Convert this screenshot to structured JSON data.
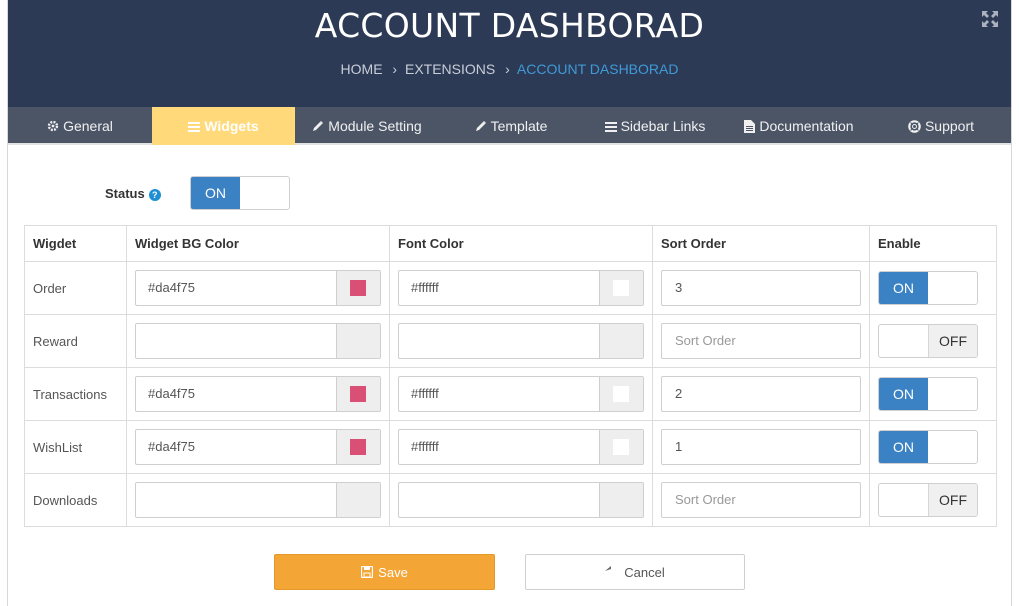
{
  "header": {
    "title": "ACCOUNT DASHBORAD",
    "breadcrumb": [
      "HOME",
      "EXTENSIONS",
      "ACCOUNT DASHBORAD"
    ]
  },
  "tabs": [
    {
      "label": "General",
      "icon": "gear-icon"
    },
    {
      "label": "Widgets",
      "icon": "list-icon",
      "active": true
    },
    {
      "label": "Module Setting",
      "icon": "pencil-icon"
    },
    {
      "label": "Template",
      "icon": "pencil-icon"
    },
    {
      "label": "Sidebar Links",
      "icon": "list-icon"
    },
    {
      "label": "Documentation",
      "icon": "document-icon"
    },
    {
      "label": "Support",
      "icon": "lifebuoy-icon"
    }
  ],
  "status": {
    "label": "Status",
    "on_label": "ON",
    "value": "on"
  },
  "table": {
    "headers": [
      "Wigdet",
      "Widget BG Color",
      "Font Color",
      "Sort Order",
      "Enable"
    ],
    "sort_placeholder": "Sort Order",
    "rows": [
      {
        "name": "Order",
        "bg_color": "#da4f75",
        "font_color": "#ffffff",
        "sort_order": "3",
        "enabled": "ON"
      },
      {
        "name": "Reward",
        "bg_color": "",
        "font_color": "",
        "sort_order": "",
        "enabled": "OFF"
      },
      {
        "name": "Transactions",
        "bg_color": "#da4f75",
        "font_color": "#ffffff",
        "sort_order": "2",
        "enabled": "ON"
      },
      {
        "name": "WishList",
        "bg_color": "#da4f75",
        "font_color": "#ffffff",
        "sort_order": "1",
        "enabled": "ON"
      },
      {
        "name": "Downloads",
        "bg_color": "",
        "font_color": "",
        "sort_order": "",
        "enabled": "OFF"
      }
    ]
  },
  "buttons": {
    "save": "Save",
    "cancel": "Cancel"
  },
  "colors": {
    "header_bg": "#2c3a55",
    "tab_bar_bg": "#4c5566",
    "active_tab_bg": "#ffd97a",
    "toggle_on": "#3b82c4",
    "save_button": "#f3a536",
    "breadcrumb_active": "#3f9ad8"
  }
}
